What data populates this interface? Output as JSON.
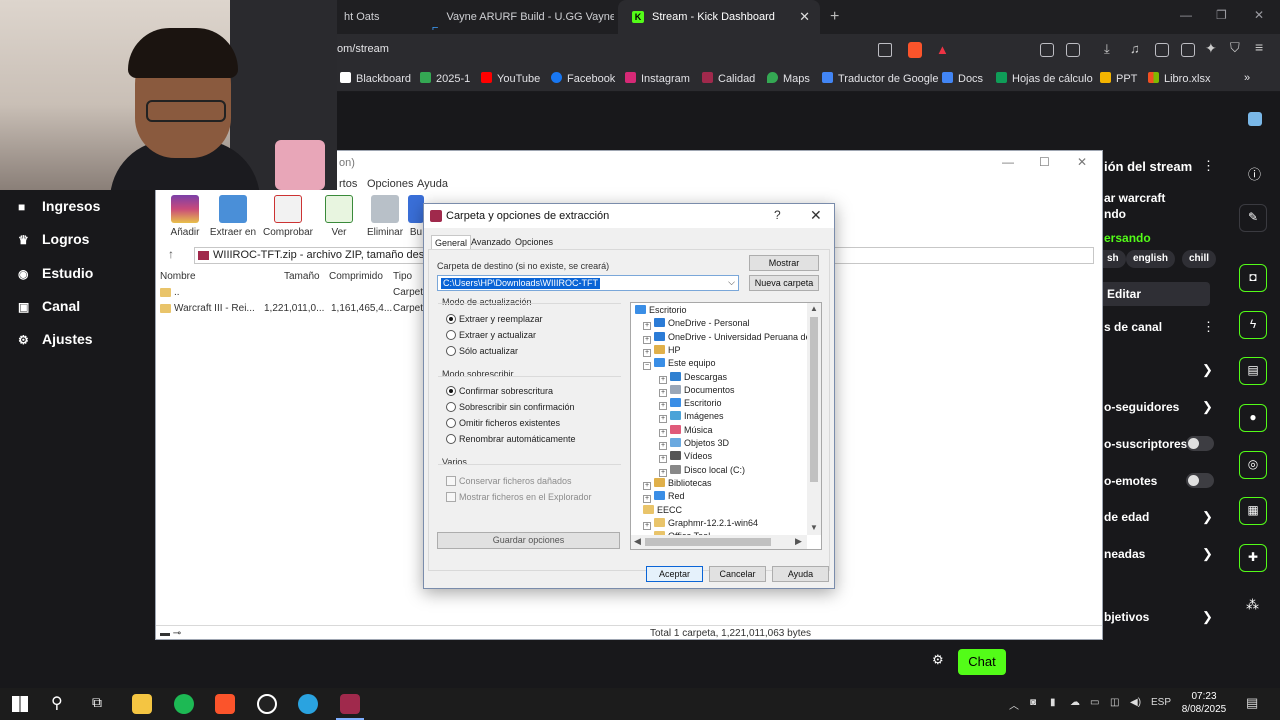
{
  "browser": {
    "tabs": [
      {
        "label": "ht Oats",
        "active": false
      },
      {
        "label": "Vayne ARURF Build - U.GG Vayne Ru",
        "active": false
      },
      {
        "label": "Stream - Kick Dashboard",
        "active": true
      }
    ],
    "new_tab": "+",
    "url": "om/stream",
    "bookmarks": [
      "Blackboard",
      "2025-1",
      "YouTube",
      "Facebook",
      "Instagram",
      "Calidad",
      "Maps",
      "Traductor de Google",
      "Docs",
      "Hojas de cálculo",
      "PPT",
      "Libro.xlsx"
    ],
    "bookmarks_more": "»"
  },
  "kick": {
    "nav": [
      {
        "icon": "money-icon",
        "glyph": "■",
        "label": "Ingresos"
      },
      {
        "icon": "trophy-icon",
        "glyph": "🏆",
        "label": "Logros"
      },
      {
        "icon": "studio-icon",
        "glyph": "◉",
        "label": "Estudio"
      },
      {
        "icon": "channel-icon",
        "glyph": "▣",
        "label": "Canal"
      },
      {
        "icon": "settings-icon",
        "glyph": "⚙",
        "label": "Ajustes"
      }
    ],
    "panel": {
      "stream_info_title": "ión del stream",
      "game_line1": "ar warcraft",
      "game_line2": "ndo",
      "status": "ersando",
      "chips": [
        "sh",
        "english",
        "chill"
      ],
      "edit_label": "Editar",
      "channel_section": "s de canal",
      "rows": [
        {
          "label": "o-seguidores",
          "control": "arrow"
        },
        {
          "label": "o-suscriptores",
          "control": "toggle"
        },
        {
          "label": "o-emotes",
          "control": "toggle"
        },
        {
          "label": "de edad",
          "control": "arrow"
        },
        {
          "label": "neadas",
          "control": "arrow"
        },
        {
          "label": "bjetivos",
          "control": "arrow"
        }
      ]
    },
    "chat_button": "Chat",
    "accent": "#53fc18"
  },
  "winrar": {
    "title": "on)",
    "menu": [
      "rtos",
      "Opciones",
      "Ayuda"
    ],
    "toolbar": [
      "Añadir",
      "Extraer en",
      "Comprobar",
      "Ver",
      "Eliminar",
      "Bu"
    ],
    "path": "WIIIROC-TFT.zip - archivo ZIP, tamaño descomp",
    "columns": [
      "Nombre",
      "Tamaño",
      "Comprimido",
      "Tipo"
    ],
    "rows": [
      {
        "name": "..",
        "size": "",
        "packed": "",
        "type": "Carpet"
      },
      {
        "name": "Warcraft III - Rei...",
        "size": "1,221,011,0...",
        "packed": "1,161,465,4...",
        "type": "Carpet"
      }
    ],
    "status_total": "Total 1 carpeta, 1,221,011,063 bytes",
    "status_drive": "▬ ⊸"
  },
  "dialog": {
    "title": "Carpeta y opciones de extracción",
    "help": "?",
    "close": "✕",
    "tabs": [
      "General",
      "Avanzado",
      "Opciones"
    ],
    "dest_label": "Carpeta de destino (si no existe, se creará)",
    "dest_value": "C:\\Users\\HP\\Downloads\\WIIIROC-TFT",
    "btn_show": "Mostrar",
    "btn_new_folder": "Nueva carpeta",
    "update_mode_label": "Modo de actualización",
    "update_modes": [
      "Extraer y reemplazar",
      "Extraer y actualizar",
      "Sólo actualizar"
    ],
    "update_selected": 0,
    "overwrite_label": "Modo sobrescribir",
    "overwrite_modes": [
      "Confirmar sobrescritura",
      "Sobrescribir sin confirmación",
      "Omitir ficheros existentes",
      "Renombrar automáticamente"
    ],
    "overwrite_selected": 0,
    "misc_label": "Varios",
    "misc": [
      "Conservar ficheros dañados",
      "Mostrar ficheros en el Explorador"
    ],
    "save_options": "Guardar opciones",
    "ok": "Aceptar",
    "cancel": "Cancelar",
    "help_btn": "Ayuda",
    "tree": [
      {
        "label": "Escritorio",
        "level": 0,
        "pm": "",
        "color": "#3a8ee6"
      },
      {
        "label": "OneDrive - Personal",
        "level": 1,
        "pm": "+",
        "color": "#2b7bd6"
      },
      {
        "label": "OneDrive - Universidad Peruana de C",
        "level": 1,
        "pm": "+",
        "color": "#2b7bd6"
      },
      {
        "label": "HP",
        "level": 1,
        "pm": "+",
        "color": "#e0b04a"
      },
      {
        "label": "Este equipo",
        "level": 1,
        "pm": "−",
        "color": "#3a8ee6"
      },
      {
        "label": "Descargas",
        "level": 2,
        "pm": "+",
        "color": "#2f80d1"
      },
      {
        "label": "Documentos",
        "level": 2,
        "pm": "+",
        "color": "#9aa7b8"
      },
      {
        "label": "Escritorio",
        "level": 2,
        "pm": "+",
        "color": "#3a8ee6"
      },
      {
        "label": "Imágenes",
        "level": 2,
        "pm": "+",
        "color": "#4aa3d8"
      },
      {
        "label": "Música",
        "level": 2,
        "pm": "+",
        "color": "#e05a7a"
      },
      {
        "label": "Objetos 3D",
        "level": 2,
        "pm": "+",
        "color": "#6aa9e0"
      },
      {
        "label": "Vídeos",
        "level": 2,
        "pm": "+",
        "color": "#555"
      },
      {
        "label": "Disco local (C:)",
        "level": 2,
        "pm": "+",
        "color": "#888"
      },
      {
        "label": "Bibliotecas",
        "level": 1,
        "pm": "+",
        "color": "#e0b04a"
      },
      {
        "label": "Red",
        "level": 1,
        "pm": "+",
        "color": "#3a8ee6"
      },
      {
        "label": "EECC",
        "level": 1,
        "pm": "",
        "color": "#e9c46a"
      },
      {
        "label": "Graphmr-12.2.1-win64",
        "level": 1,
        "pm": "+",
        "color": "#e9c46a"
      },
      {
        "label": "Office Tool",
        "level": 1,
        "pm": "+",
        "color": "#e9c46a"
      }
    ]
  },
  "taskbar": {
    "lang": "ESP",
    "time": "07:23",
    "date": "8/08/2025"
  }
}
